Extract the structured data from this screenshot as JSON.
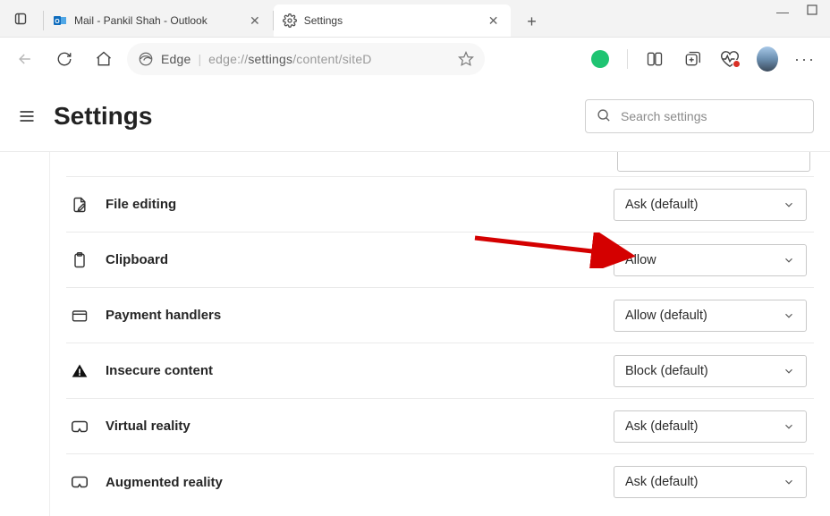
{
  "tabs": [
    {
      "title": "Mail - Pankil Shah - Outlook"
    },
    {
      "title": "Settings"
    }
  ],
  "url": {
    "prefix_engine": "Edge",
    "dim1": "edge://",
    "norm": "settings",
    "dim2": "/content/siteD"
  },
  "header": {
    "title": "Settings",
    "search_placeholder": "Search settings"
  },
  "rows": [
    {
      "icon": "file-editing-icon",
      "label": "File editing",
      "value": "Ask (default)"
    },
    {
      "icon": "clipboard-icon",
      "label": "Clipboard",
      "value": "Allow"
    },
    {
      "icon": "payment-icon",
      "label": "Payment handlers",
      "value": "Allow (default)"
    },
    {
      "icon": "warning-icon",
      "label": "Insecure content",
      "value": "Block (default)"
    },
    {
      "icon": "vr-icon",
      "label": "Virtual reality",
      "value": "Ask (default)"
    },
    {
      "icon": "ar-icon",
      "label": "Augmented reality",
      "value": "Ask (default)"
    }
  ]
}
